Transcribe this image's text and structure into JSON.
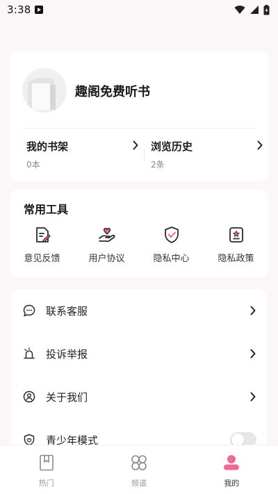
{
  "status": {
    "time": "3:38"
  },
  "profile": {
    "name": "趣阁免费听书"
  },
  "stats": [
    {
      "title": "我的书架",
      "count": "0本"
    },
    {
      "title": "浏览历史",
      "count": "2条"
    }
  ],
  "tools": {
    "title": "常用工具",
    "items": [
      {
        "label": "意见反馈",
        "icon": "feedback-icon"
      },
      {
        "label": "用户协议",
        "icon": "agreement-icon"
      },
      {
        "label": "隐私中心",
        "icon": "privacy-center-icon"
      },
      {
        "label": "隐私政策",
        "icon": "privacy-policy-icon"
      }
    ]
  },
  "menu": [
    {
      "label": "联系客服",
      "icon": "chat-icon"
    },
    {
      "label": "投诉举报",
      "icon": "alarm-icon"
    },
    {
      "label": "关于我们",
      "icon": "user-circle-icon"
    },
    {
      "label": "青少年模式",
      "icon": "shield-icon",
      "toggle": false
    }
  ],
  "nav": [
    {
      "label": "热门",
      "icon": "bookmark-icon",
      "active": false
    },
    {
      "label": "频道",
      "icon": "grid-icon",
      "active": false
    },
    {
      "label": "我的",
      "icon": "profile-icon",
      "active": true
    }
  ],
  "colors": {
    "accent": "#f06a99",
    "icon_stroke": "#2a2a2a",
    "background": "#fbf6f8"
  }
}
